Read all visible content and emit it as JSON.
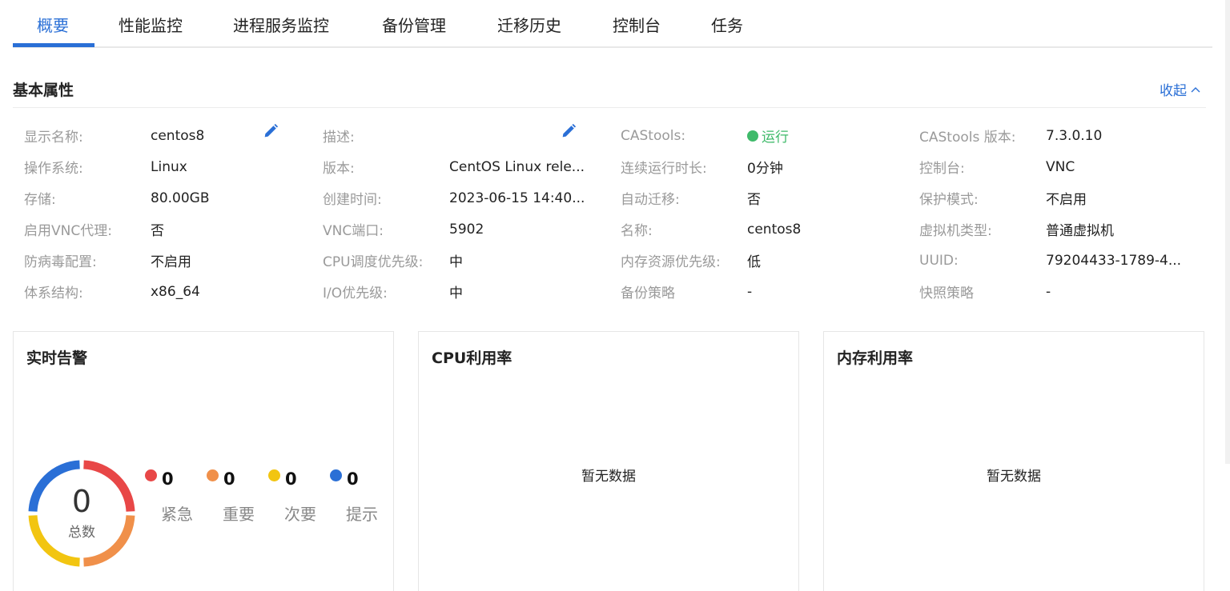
{
  "tabs": [
    {
      "label": "概要",
      "active": true
    },
    {
      "label": "性能监控",
      "active": false
    },
    {
      "label": "进程服务监控",
      "active": false
    },
    {
      "label": "备份管理",
      "active": false
    },
    {
      "label": "迁移历史",
      "active": false
    },
    {
      "label": "控制台",
      "active": false
    },
    {
      "label": "任务",
      "active": false
    }
  ],
  "basic": {
    "title": "基本属性",
    "collapse_label": "收起"
  },
  "properties": {
    "col1": [
      {
        "label": "显示名称:",
        "value": "centos8"
      },
      {
        "label": "操作系统:",
        "value": "Linux"
      },
      {
        "label": "存储:",
        "value": "80.00GB"
      },
      {
        "label": "启用VNC代理:",
        "value": "否"
      },
      {
        "label": "防病毒配置:",
        "value": "不启用"
      },
      {
        "label": "体系结构:",
        "value": "x86_64"
      }
    ],
    "col2": [
      {
        "label": "描述:",
        "value": ""
      },
      {
        "label": "版本:",
        "value": "CentOS Linux rele..."
      },
      {
        "label": "创建时间:",
        "value": "2023-06-15 14:40..."
      },
      {
        "label": "VNC端口:",
        "value": "5902"
      },
      {
        "label": "CPU调度优先级:",
        "value": "中"
      },
      {
        "label": "I/O优先级:",
        "value": "中"
      }
    ],
    "col3": [
      {
        "label": "CAStools:",
        "value": "运行"
      },
      {
        "label": "连续运行时长:",
        "value": "0分钟"
      },
      {
        "label": "自动迁移:",
        "value": "否"
      },
      {
        "label": "名称:",
        "value": "centos8"
      },
      {
        "label": "内存资源优先级:",
        "value": "低"
      },
      {
        "label": "备份策略",
        "value": "-"
      }
    ],
    "col4": [
      {
        "label": "CAStools 版本:",
        "value": "7.3.0.10"
      },
      {
        "label": "控制台:",
        "value": "VNC"
      },
      {
        "label": "保护模式:",
        "value": "不启用"
      },
      {
        "label": "虚拟机类型:",
        "value": "普通虚拟机"
      },
      {
        "label": "UUID:",
        "value": "79204433-1789-4..."
      },
      {
        "label": "快照策略",
        "value": "-"
      }
    ]
  },
  "alerts": {
    "title": "实时告警",
    "total": "0",
    "total_label": "总数",
    "levels": [
      {
        "name": "紧急",
        "count": "0",
        "color": "#e84747"
      },
      {
        "name": "重要",
        "count": "0",
        "color": "#f0904a"
      },
      {
        "name": "次要",
        "count": "0",
        "color": "#f2c511"
      },
      {
        "name": "提示",
        "count": "0",
        "color": "#2a6fd6"
      }
    ]
  },
  "cpu": {
    "title": "CPU利用率",
    "empty": "暂无数据"
  },
  "memory": {
    "title": "内存利用率",
    "empty": "暂无数据"
  },
  "colors": {
    "accent": "#2a6fd6",
    "running": "#3fba6a"
  }
}
